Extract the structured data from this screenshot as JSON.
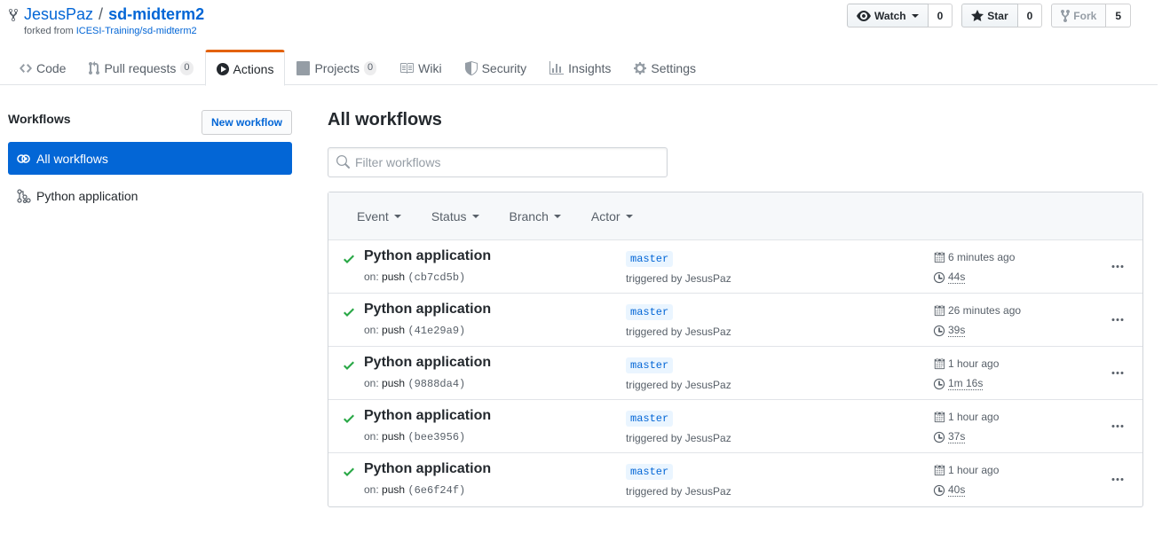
{
  "repo": {
    "owner": "JesusPaz",
    "name": "sd-midterm2",
    "forked_prefix": "forked from",
    "forked_from": "ICESI-Training/sd-midterm2"
  },
  "actions": {
    "watch_label": "Watch",
    "watch_count": "0",
    "star_label": "Star",
    "star_count": "0",
    "fork_label": "Fork",
    "fork_count": "5"
  },
  "nav": [
    {
      "label": "Code",
      "icon": "code-icon"
    },
    {
      "label": "Pull requests",
      "counter": "0",
      "icon": "pull-request-icon"
    },
    {
      "label": "Actions",
      "icon": "play-icon",
      "selected": true
    },
    {
      "label": "Projects",
      "counter": "0",
      "icon": "project-icon"
    },
    {
      "label": "Wiki",
      "icon": "book-icon"
    },
    {
      "label": "Security",
      "icon": "shield-icon"
    },
    {
      "label": "Insights",
      "icon": "graph-icon"
    },
    {
      "label": "Settings",
      "icon": "gear-icon"
    }
  ],
  "sidebar": {
    "heading": "Workflows",
    "new_workflow": "New workflow",
    "items": [
      {
        "label": "All workflows",
        "active": true
      },
      {
        "label": "Python application"
      }
    ]
  },
  "main": {
    "heading": "All workflows",
    "filter_placeholder": "Filter workflows",
    "filters": [
      "Event",
      "Status",
      "Branch",
      "Actor"
    ],
    "runs": [
      {
        "title": "Python application",
        "on": "on:",
        "event": "push",
        "sha": "(cb7cd5b)",
        "branch": "master",
        "triggered": "triggered by JesusPaz",
        "when": "6 minutes ago",
        "duration": "44s"
      },
      {
        "title": "Python application",
        "on": "on:",
        "event": "push",
        "sha": "(41e29a9)",
        "branch": "master",
        "triggered": "triggered by JesusPaz",
        "when": "26 minutes ago",
        "duration": "39s"
      },
      {
        "title": "Python application",
        "on": "on:",
        "event": "push",
        "sha": "(9888da4)",
        "branch": "master",
        "triggered": "triggered by JesusPaz",
        "when": "1 hour ago",
        "duration": "1m 16s"
      },
      {
        "title": "Python application",
        "on": "on:",
        "event": "push",
        "sha": "(bee3956)",
        "branch": "master",
        "triggered": "triggered by JesusPaz",
        "when": "1 hour ago",
        "duration": "37s"
      },
      {
        "title": "Python application",
        "on": "on:",
        "event": "push",
        "sha": "(6e6f24f)",
        "branch": "master",
        "triggered": "triggered by JesusPaz",
        "when": "1 hour ago",
        "duration": "40s"
      }
    ]
  },
  "colors": {
    "accent": "#0366d6",
    "success": "#28a745",
    "selected_tab": "#e36209"
  }
}
